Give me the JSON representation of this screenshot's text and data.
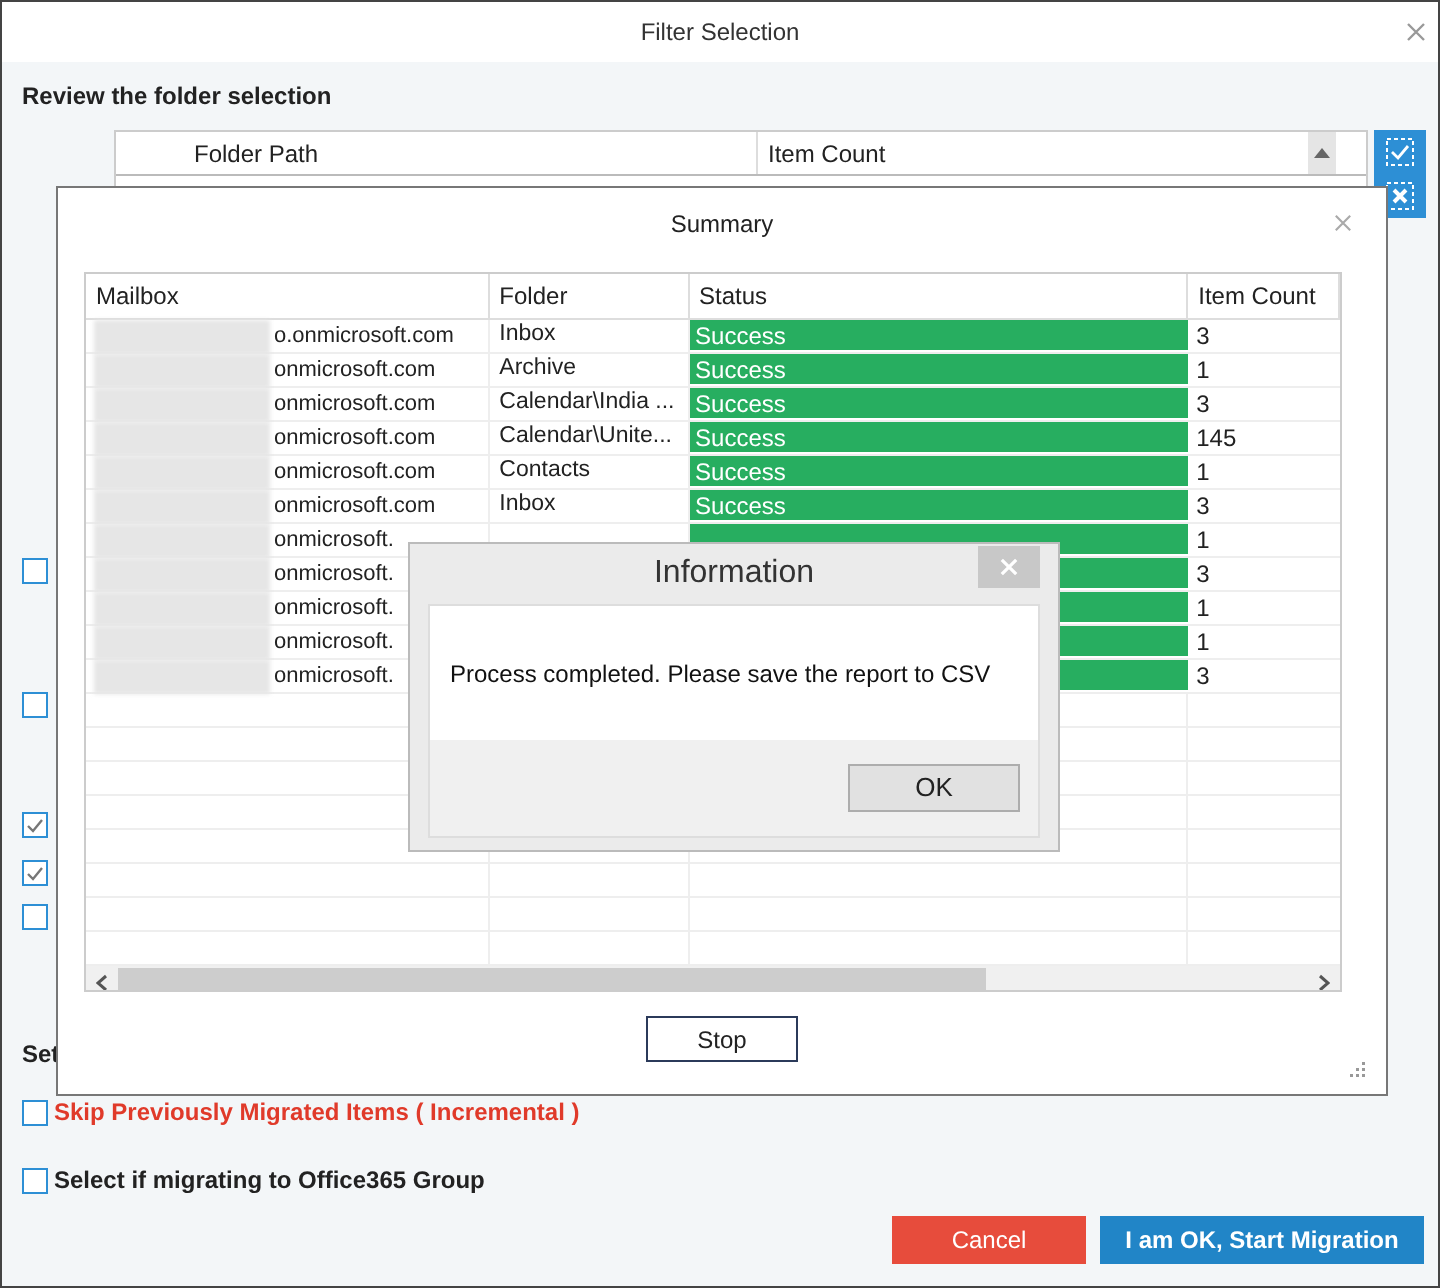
{
  "window": {
    "title": "Filter Selection"
  },
  "review": {
    "heading": "Review the folder selection",
    "columns": [
      "Folder Path",
      "Item Count"
    ]
  },
  "side_checkboxes": [
    {
      "checked": false
    },
    {
      "checked": false
    },
    {
      "checked": true
    },
    {
      "checked": true
    },
    {
      "checked": false
    }
  ],
  "settings_heading": "Set",
  "options": [
    {
      "label": "Skip Previously Migrated Items ( Incremental )",
      "checked": false,
      "kind": "warning"
    },
    {
      "label": "Select if migrating to Office365 Group",
      "checked": false,
      "kind": "normal"
    }
  ],
  "buttons": [
    {
      "label": "Cancel",
      "kind": "danger"
    },
    {
      "label": "I am OK, Start Migration",
      "kind": "primary"
    }
  ],
  "summary": {
    "title": "Summary",
    "columns": [
      "Mailbox",
      "Folder",
      "Status",
      "Item Count"
    ],
    "rows": [
      {
        "mailbox": "o.onmicrosoft.com",
        "folder": "Inbox",
        "status": "Success",
        "color": "#27ae60",
        "count": "3"
      },
      {
        "mailbox": "onmicrosoft.com",
        "folder": "Archive",
        "status": "Success",
        "color": "#27ae60",
        "count": "1"
      },
      {
        "mailbox": "onmicrosoft.com",
        "folder": "Calendar\\India ...",
        "status": "Success",
        "color": "#27ae60",
        "count": "3"
      },
      {
        "mailbox": "onmicrosoft.com",
        "folder": "Calendar\\Unite...",
        "status": "Success",
        "color": "#27ae60",
        "count": "145"
      },
      {
        "mailbox": "onmicrosoft.com",
        "folder": "Contacts",
        "status": "Success",
        "color": "#27ae60",
        "count": "1"
      },
      {
        "mailbox": "onmicrosoft.com",
        "folder": "Inbox",
        "status": "Success",
        "color": "#27ae60",
        "count": "3"
      },
      {
        "mailbox": "onmicrosoft.",
        "color": "#27ae60",
        "count": "1"
      },
      {
        "mailbox": "onmicrosoft.",
        "color": "#27ae60",
        "count": "3"
      },
      {
        "mailbox": "onmicrosoft.",
        "color": "#27ae60",
        "count": "1"
      },
      {
        "mailbox": "onmicrosoft.",
        "color": "#27ae60",
        "count": "1"
      },
      {
        "mailbox": "onmicrosoft.",
        "color": "#27ae60",
        "count": "3"
      }
    ],
    "stop_button": "Stop"
  },
  "dialog": {
    "title": "Information",
    "message": "Process completed. Please save the report to CSV",
    "ok_button": "OK"
  }
}
